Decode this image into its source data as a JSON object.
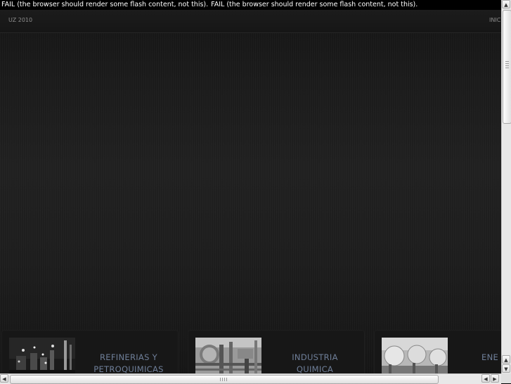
{
  "fail_message": {
    "first": "FAIL (the browser should render some flash content, not this).",
    "second": "FAIL (the browser should render some flash content, not this)."
  },
  "nav": {
    "brand": "UZ 2010",
    "link": "INIC"
  },
  "cards": [
    {
      "label_line1": "REFINERIAS Y",
      "label_line2": "PETROQUIMICAS"
    },
    {
      "label_line1": "INDUSTRIA",
      "label_line2": "QUIMICA"
    },
    {
      "label_line1": "ENE",
      "label_line2": ""
    }
  ],
  "icons": {
    "scroll_up": "up-arrow-icon",
    "scroll_down": "down-arrow-icon",
    "scroll_left": "left-arrow-icon",
    "scroll_right": "right-arrow-icon"
  }
}
